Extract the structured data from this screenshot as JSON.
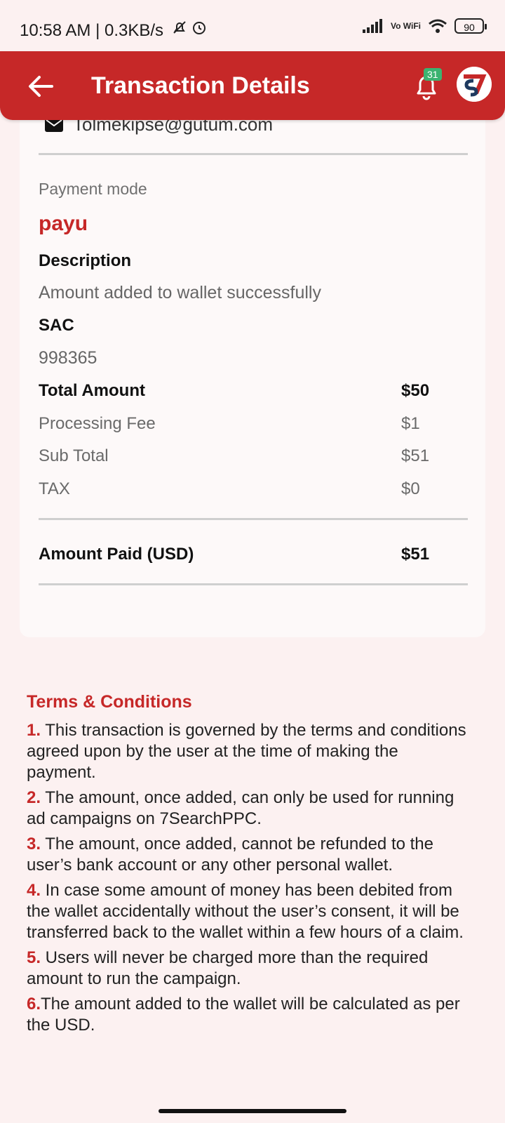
{
  "status_bar": {
    "time_speed": "10:58 AM | 0.3KB/s",
    "vowifi": "Vo WiFi",
    "battery": "90"
  },
  "app_bar": {
    "title": "Transaction Details",
    "notification_count": "31",
    "back_icon": "arrow-left-icon",
    "bell_icon": "bell-icon",
    "logo_icon": "7search-logo",
    "color": "#c62828"
  },
  "card": {
    "email": "Tolmekipse@gutum.com",
    "payment_mode_label": "Payment mode",
    "payment_mode_value": "payu",
    "description_label": "Description",
    "description_value": "Amount added to wallet successfully",
    "sac_label": "SAC",
    "sac_value": "998365",
    "rows": [
      {
        "label": "Total Amount",
        "value": "$50"
      },
      {
        "label": "Processing Fee",
        "value": "$1"
      },
      {
        "label": "Sub Total",
        "value": "$51"
      },
      {
        "label": "TAX",
        "value": "$0"
      }
    ],
    "amount_paid_label": "Amount Paid (USD)",
    "amount_paid_value": "$51"
  },
  "terms": {
    "title": "Terms & Conditions",
    "items": [
      {
        "num": "1.",
        "text": " This transaction is governed by the terms and conditions agreed upon by the user at the time of making the payment."
      },
      {
        "num": "2.",
        "text": " The amount, once added, can only be used for running ad campaigns on 7SearchPPC."
      },
      {
        "num": "3.",
        "text": " The amount, once added, cannot be refunded to the user’s bank account or any other personal wallet."
      },
      {
        "num": "4.",
        "text": " In case some amount of money has been debited from the wallet accidentally without the user’s consent, it will be transferred back to the wallet within a few hours of a claim."
      },
      {
        "num": "5.",
        "text": " Users will never be charged more than the required amount to run the campaign."
      },
      {
        "num": "6.",
        "text": "The amount added to the wallet will be calculated as per the USD."
      }
    ]
  }
}
